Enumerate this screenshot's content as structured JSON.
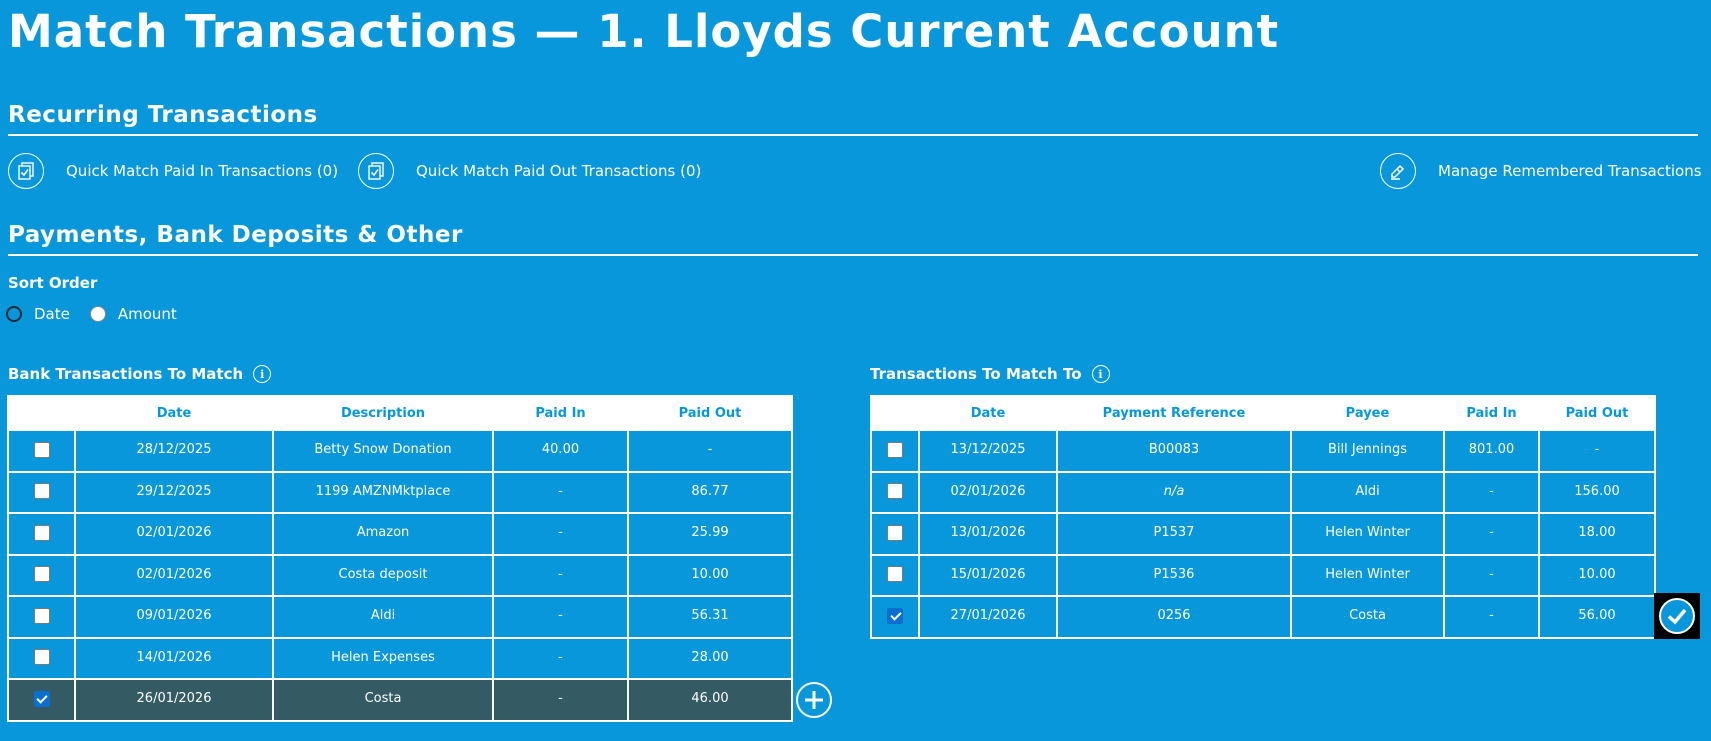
{
  "page": {
    "title": "Match Transactions — 1. Lloyds Current Account"
  },
  "recurring": {
    "heading": "Recurring Transactions",
    "quick_paid_in": "Quick Match Paid In Transactions (0)",
    "quick_paid_out": "Quick Match Paid Out Transactions (0)",
    "manage_remembered": "Manage Remembered Transactions"
  },
  "payments": {
    "heading": "Payments, Bank Deposits & Other",
    "sort_label": "Sort Order",
    "sort_options": [
      "Date",
      "Amount"
    ]
  },
  "bank_table": {
    "title": "Bank Transactions To Match",
    "columns": [
      "",
      "Date",
      "Description",
      "Paid In",
      "Paid Out"
    ],
    "rows": [
      {
        "checked": false,
        "date": "28/12/2025",
        "description": "Betty Snow Donation",
        "paid_in": "40.00",
        "paid_out": "-"
      },
      {
        "checked": false,
        "date": "29/12/2025",
        "description": "1199 AMZNMktplace",
        "paid_in": "-",
        "paid_out": "86.77"
      },
      {
        "checked": false,
        "date": "02/01/2026",
        "description": "Amazon",
        "paid_in": "-",
        "paid_out": "25.99"
      },
      {
        "checked": false,
        "date": "02/01/2026",
        "description": "Costa deposit",
        "paid_in": "-",
        "paid_out": "10.00"
      },
      {
        "checked": false,
        "date": "09/01/2026",
        "description": "Aldi",
        "paid_in": "-",
        "paid_out": "56.31"
      },
      {
        "checked": false,
        "date": "14/01/2026",
        "description": "Helen Expenses",
        "paid_in": "-",
        "paid_out": "28.00"
      },
      {
        "checked": true,
        "date": "26/01/2026",
        "description": "Costa",
        "paid_in": "-",
        "paid_out": "46.00"
      }
    ]
  },
  "match_table": {
    "title": "Transactions To Match To",
    "columns": [
      "",
      "Date",
      "Payment Reference",
      "Payee",
      "Paid In",
      "Paid Out"
    ],
    "rows": [
      {
        "checked": false,
        "date": "13/12/2025",
        "reference": "B00083",
        "payee": "Bill Jennings",
        "paid_in": "801.00",
        "paid_out": "-"
      },
      {
        "checked": false,
        "date": "02/01/2026",
        "reference": "n/a",
        "payee": "Aldi",
        "paid_in": "-",
        "paid_out": "156.00"
      },
      {
        "checked": false,
        "date": "13/01/2026",
        "reference": "P1537",
        "payee": "Helen Winter",
        "paid_in": "-",
        "paid_out": "18.00"
      },
      {
        "checked": false,
        "date": "15/01/2026",
        "reference": "P1536",
        "payee": "Helen Winter",
        "paid_in": "-",
        "paid_out": "10.00"
      },
      {
        "checked": true,
        "date": "27/01/2026",
        "reference": "0256",
        "payee": "Costa",
        "paid_in": "-",
        "paid_out": "56.00"
      }
    ]
  },
  "icons": {
    "quick_match": "clipboard-check-icon",
    "manage": "pencil-eraser-icon",
    "info": "info-icon",
    "add": "plus-circle-icon",
    "confirm": "check-circle-icon"
  },
  "colors": {
    "background": "#0997dc",
    "header_bg": "#ffffff",
    "header_text": "#0997dc",
    "selected_row": "#345a64",
    "checkbox_checked": "#0b6fd0"
  }
}
